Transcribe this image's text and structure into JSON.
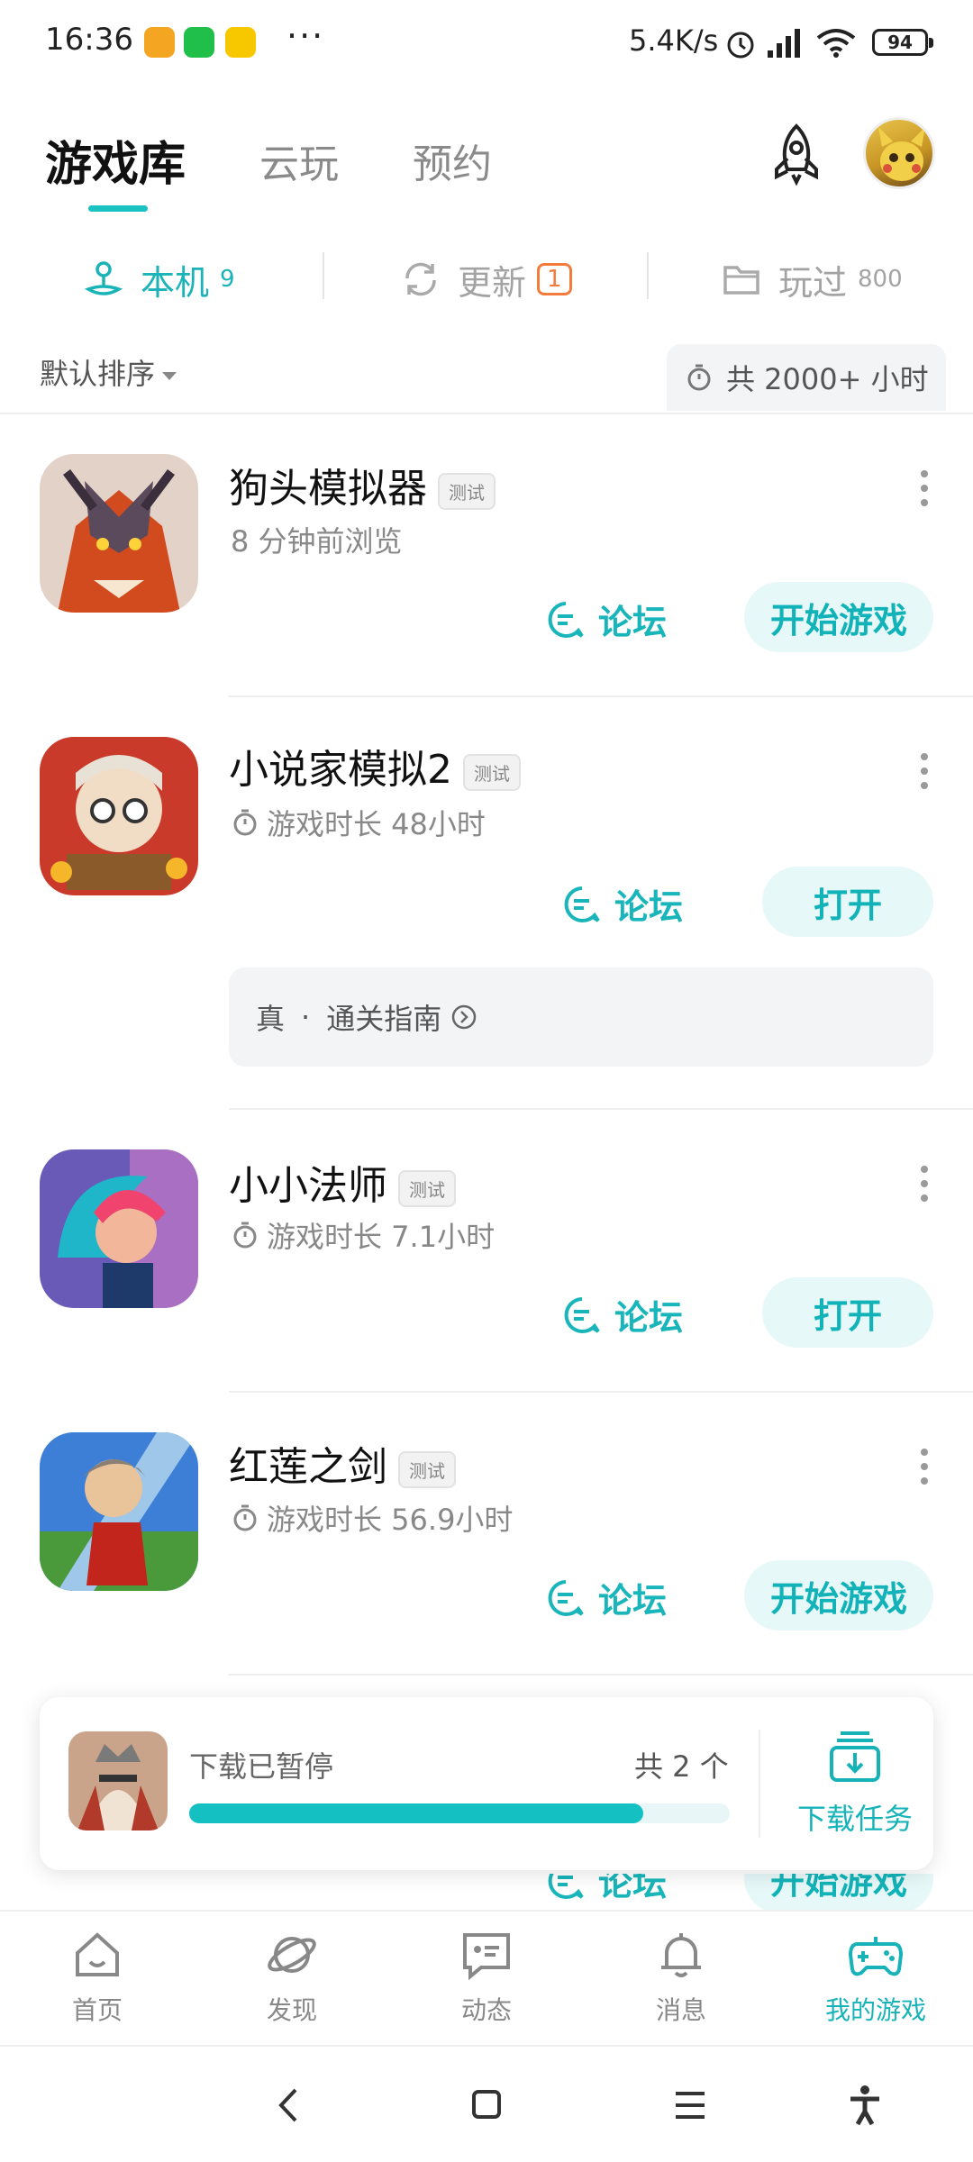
{
  "status_bar": {
    "time": "16:36",
    "more_indicator": "···",
    "net_speed": "5.4K/s",
    "battery": "94",
    "icons": [
      "alarm-icon",
      "signal-icon",
      "wifi-icon",
      "battery-icon"
    ]
  },
  "header": {
    "tabs": [
      {
        "label": "游戏库",
        "active": true
      },
      {
        "label": "云玩",
        "active": false
      },
      {
        "label": "预约",
        "active": false
      }
    ]
  },
  "subtabs": [
    {
      "label": "本机",
      "count": "9",
      "icon": "local-device-icon"
    },
    {
      "label": "更新",
      "badge": "1",
      "icon": "refresh-icon"
    },
    {
      "label": "玩过",
      "count": "800",
      "icon": "folder-icon"
    }
  ],
  "sort": {
    "label": "默认排序"
  },
  "total_time": "共 2000+ 小时",
  "games": [
    {
      "title": "狗头模拟器",
      "tag": "测试",
      "subtitle": "8 分钟前浏览",
      "forum": "论坛",
      "action": "开始游戏"
    },
    {
      "title": "小说家模拟2",
      "tag": "测试",
      "subtitle": "游戏时长 48小时",
      "forum": "论坛",
      "action": "打开",
      "guide": {
        "label1": "真",
        "dot": "·",
        "label2": "通关指南"
      }
    },
    {
      "title": "小小法师",
      "tag": "测试",
      "subtitle": "游戏时长 7.1小时",
      "forum": "论坛",
      "action": "打开"
    },
    {
      "title": "红莲之剑",
      "tag": "测试",
      "subtitle": "游戏时长 56.9小时",
      "forum": "论坛",
      "action": "开始游戏"
    }
  ],
  "partial_row": {
    "forum": "论坛",
    "action": "开始游戏"
  },
  "download": {
    "status": "下载已暂停",
    "count": "共 2 个",
    "progress": 0.84,
    "task_label": "下载任务"
  },
  "bottom_nav": [
    {
      "label": "首页",
      "icon": "home-icon"
    },
    {
      "label": "发现",
      "icon": "discover-planet-icon"
    },
    {
      "label": "动态",
      "icon": "feed-message-icon"
    },
    {
      "label": "消息",
      "icon": "bell-icon"
    },
    {
      "label": "我的游戏",
      "icon": "gamepad-icon",
      "active": true
    }
  ],
  "colors": {
    "accent": "#1ab3b8",
    "badge": "#f37b3b",
    "pill_bg": "#e6f8f8"
  }
}
